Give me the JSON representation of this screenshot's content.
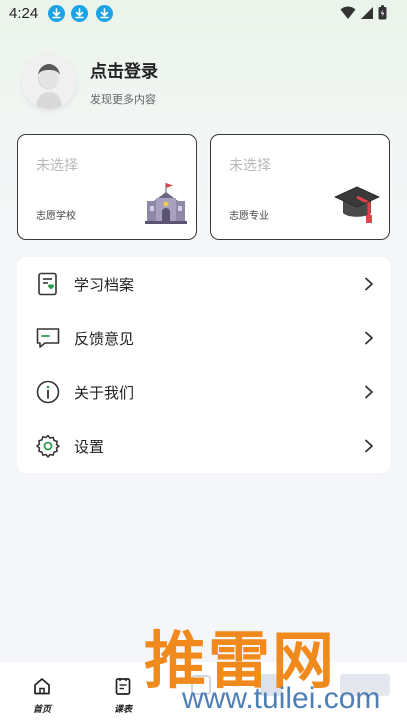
{
  "status_bar": {
    "time": "4:24",
    "download_icons": [
      "download-icon",
      "download-icon",
      "download-icon"
    ],
    "right_icons": [
      "wifi-icon",
      "signal-icon",
      "battery-icon"
    ]
  },
  "profile": {
    "title": "点击登录",
    "subtitle": "发现更多内容"
  },
  "cards": [
    {
      "value": "未选择",
      "label": "志愿学校",
      "icon": "school-building-icon"
    },
    {
      "value": "未选择",
      "label": "志愿专业",
      "icon": "graduation-cap-icon"
    }
  ],
  "menu": {
    "items": [
      {
        "label": "学习档案",
        "icon": "study-file-icon"
      },
      {
        "label": "反馈意见",
        "icon": "feedback-icon"
      },
      {
        "label": "关于我们",
        "icon": "info-icon"
      },
      {
        "label": "设置",
        "icon": "gear-icon"
      }
    ]
  },
  "tabbar": {
    "tabs": [
      {
        "label": "首页",
        "icon": "home-icon"
      },
      {
        "label": "课表",
        "icon": "schedule-icon"
      }
    ]
  },
  "watermark": {
    "brand": "推雷网",
    "url": "www.tuilei.com"
  },
  "colors": {
    "accent_green": "#2e9b4e",
    "download_blue": "#1aa3e8",
    "watermark_orange": "#f08a1c",
    "watermark_blue": "#4e7fb5"
  }
}
